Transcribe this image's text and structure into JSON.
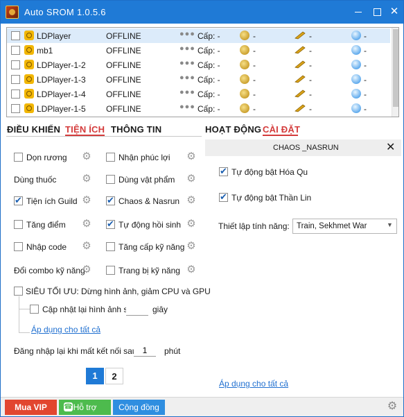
{
  "window": {
    "title": "Auto SROM 1.0.5.6",
    "minimize": "",
    "maximize": "",
    "close": "✕"
  },
  "devices": [
    {
      "name": "LDPlayer",
      "status": "OFFLINE",
      "dots": "●●●",
      "cap": "Cấp: -",
      "v1": "-",
      "v2": "-",
      "v3": "-",
      "selected": true
    },
    {
      "name": "mb1",
      "status": "OFFLINE",
      "dots": "●●●",
      "cap": "Cấp: -",
      "v1": "-",
      "v2": "-",
      "v3": "-"
    },
    {
      "name": "LDPlayer-1-2",
      "status": "OFFLINE",
      "dots": "●●●",
      "cap": "Cấp: -",
      "v1": "-",
      "v2": "-",
      "v3": "-"
    },
    {
      "name": "LDPlayer-1-3",
      "status": "OFFLINE",
      "dots": "●●●",
      "cap": "Cấp: -",
      "v1": "-",
      "v2": "-",
      "v3": "-"
    },
    {
      "name": "LDPlayer-1-4",
      "status": "OFFLINE",
      "dots": "●●●",
      "cap": "Cấp: -",
      "v1": "-",
      "v2": "-",
      "v3": "-"
    },
    {
      "name": "LDPlayer-1-5",
      "status": "OFFLINE",
      "dots": "●●●",
      "cap": "Cấp: -",
      "v1": "-",
      "v2": "-",
      "v3": "-"
    }
  ],
  "left_tabs": {
    "control": "ĐIỀU KHIỂN",
    "utility": "TIỆN ÍCH",
    "info": "THÔNG TIN",
    "active": "utility"
  },
  "right_tabs": {
    "activity": "HOẠT ĐỘNG",
    "settings": "CÀI ĐẶT",
    "active": "settings"
  },
  "utility": {
    "don_ruong": "Dọn rương",
    "nhan_phuc_loi": "Nhận phúc lợi",
    "dung_thuoc": "Dùng thuốc",
    "dung_vat_pham": "Dùng vật phẩm",
    "tien_ich_guild": "Tiện ích Guild",
    "chaos_nasrun": "Chaos & Nasrun",
    "tang_diem": "Tăng điểm",
    "tu_dong_hoi_sinh": "Tự động hồi sinh",
    "nhap_code": "Nhập code",
    "tang_cap_ky_nang": "Tăng cấp kỹ năng",
    "doi_combo": "Đổi combo kỹ năng",
    "trang_bi_ky_nang": "Trang bị kỹ năng",
    "sieu_toi_uu": "SIÊU TỐI ƯU: Dừng hình ảnh, giảm CPU và GPU",
    "cap_nhat_hinh_anh": "Cập nhật lại hình ảnh sau",
    "cap_nhat_value": "",
    "giay": "giây",
    "apply_all": "Áp dụng cho tất cả",
    "relogin_label": "Đăng nhập lại khi mất kết nối sau",
    "relogin_value": "1",
    "phut": "phút",
    "checked": [
      "tien_ich_guild",
      "chaos_nasrun",
      "tu_dong_hoi_sinh"
    ]
  },
  "pagination": {
    "page1": "1",
    "page2": "2",
    "current": 1
  },
  "settings_panel": {
    "title": "CHAOS _NASRUN",
    "close": "✕",
    "opt1": "Tự động bật Hóa Qu",
    "opt2": "Tự động bật Thần Lin",
    "feature_label": "Thiết lập tính năng:",
    "feature_value": "Train, Sekhmet War",
    "apply_all": "Áp dụng cho tất cả"
  },
  "bottom": {
    "vip": "Mua VIP",
    "help": "Hỗ trợ",
    "community": "Cộng đồng"
  },
  "colors": {
    "titlebar": "#1f7ad6",
    "accent_red": "#d43b3b",
    "vip": "#e2462f",
    "help": "#4dbb4d",
    "community": "#2f8ee0",
    "link": "#1f6fd0"
  }
}
